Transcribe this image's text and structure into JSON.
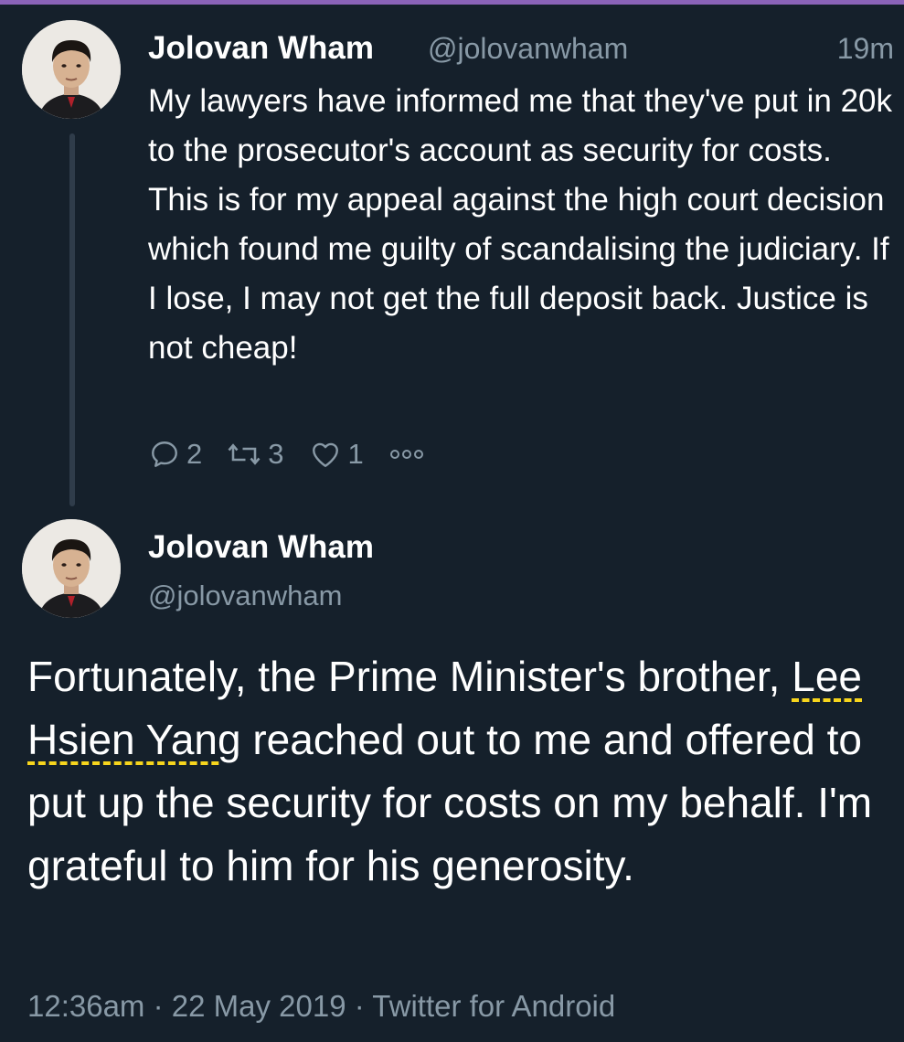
{
  "colors": {
    "background": "#15202b",
    "text_primary": "#ffffff",
    "text_secondary": "#8899a6",
    "thread_line": "#2f3c4a",
    "mention_underline": "#f7d51d",
    "top_accent": "#8a63b8"
  },
  "reply_tweet": {
    "author_name": "Jolovan Wham",
    "handle": "@jolovanwham",
    "time": "19m",
    "text": "My lawyers have informed me that they've put in 20k to the prosecutor's account as security for costs. This is for my appeal against the high court decision which found me guilty of scandalising the judiciary. If I lose, I may not get the full deposit back. Justice is not cheap!",
    "actions": {
      "reply_icon": "reply-icon",
      "reply_count": "2",
      "retweet_icon": "retweet-icon",
      "retweet_count": "3",
      "like_icon": "heart-icon",
      "like_count": "1",
      "more_icon": "more-icon"
    }
  },
  "main_tweet": {
    "author_name": "Jolovan Wham",
    "handle": "@jolovanwham",
    "text_before": "Fortunately, the Prime Minister's brother, ",
    "mention": "Lee Hsien Yang",
    "text_after": " reached out to me and offered to put up the security for costs on my behalf. I'm grateful to him for his generosity.",
    "meta": "12:36am · 22 May 2019 · Twitter for Android"
  }
}
